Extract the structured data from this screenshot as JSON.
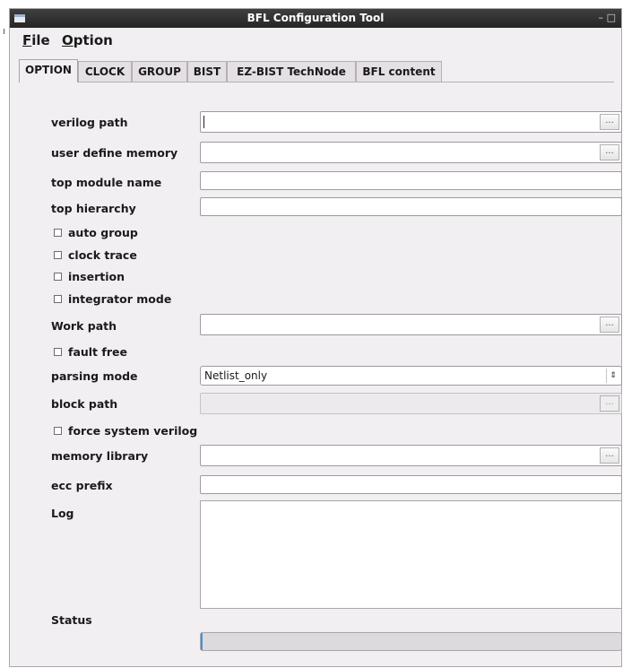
{
  "window": {
    "title": "BFL Configuration Tool",
    "minimize": "–",
    "maximize": "□"
  },
  "menu": {
    "file": "File",
    "option": "Option",
    "file_mnemonic": "F",
    "file_rest": "ile",
    "option_mnemonic": "O",
    "option_rest": "ption"
  },
  "tabs": [
    "OPTION",
    "CLOCK",
    "GROUP",
    "BIST",
    "EZ-BIST TechNode",
    "BFL content"
  ],
  "form": {
    "verilog_path": {
      "label": "verilog path",
      "value": ""
    },
    "user_define_memory": {
      "label": "user define memory",
      "value": ""
    },
    "top_module_name": {
      "label": "top module name",
      "value": ""
    },
    "top_hierarchy": {
      "label": "top hierarchy",
      "value": ""
    },
    "auto_group": {
      "label": "auto group",
      "checked": false
    },
    "clock_trace": {
      "label": "clock trace",
      "checked": false
    },
    "insertion": {
      "label": "insertion",
      "checked": false
    },
    "integrator_mode": {
      "label": "integrator mode",
      "checked": false
    },
    "work_path": {
      "label": "Work path",
      "value": ""
    },
    "fault_free": {
      "label": "fault free",
      "checked": false
    },
    "parsing_mode": {
      "label": "parsing mode",
      "value": "Netlist_only"
    },
    "block_path": {
      "label": "block path",
      "value": ""
    },
    "force_system_verilog": {
      "label": "force system verilog",
      "checked": false
    },
    "memory_library": {
      "label": "memory library",
      "value": ""
    },
    "ecc_prefix": {
      "label": "ecc prefix",
      "value": ""
    },
    "log": {
      "label": "Log",
      "value": ""
    },
    "status": {
      "label": "Status",
      "progress": 0
    }
  },
  "browse_label": "..."
}
